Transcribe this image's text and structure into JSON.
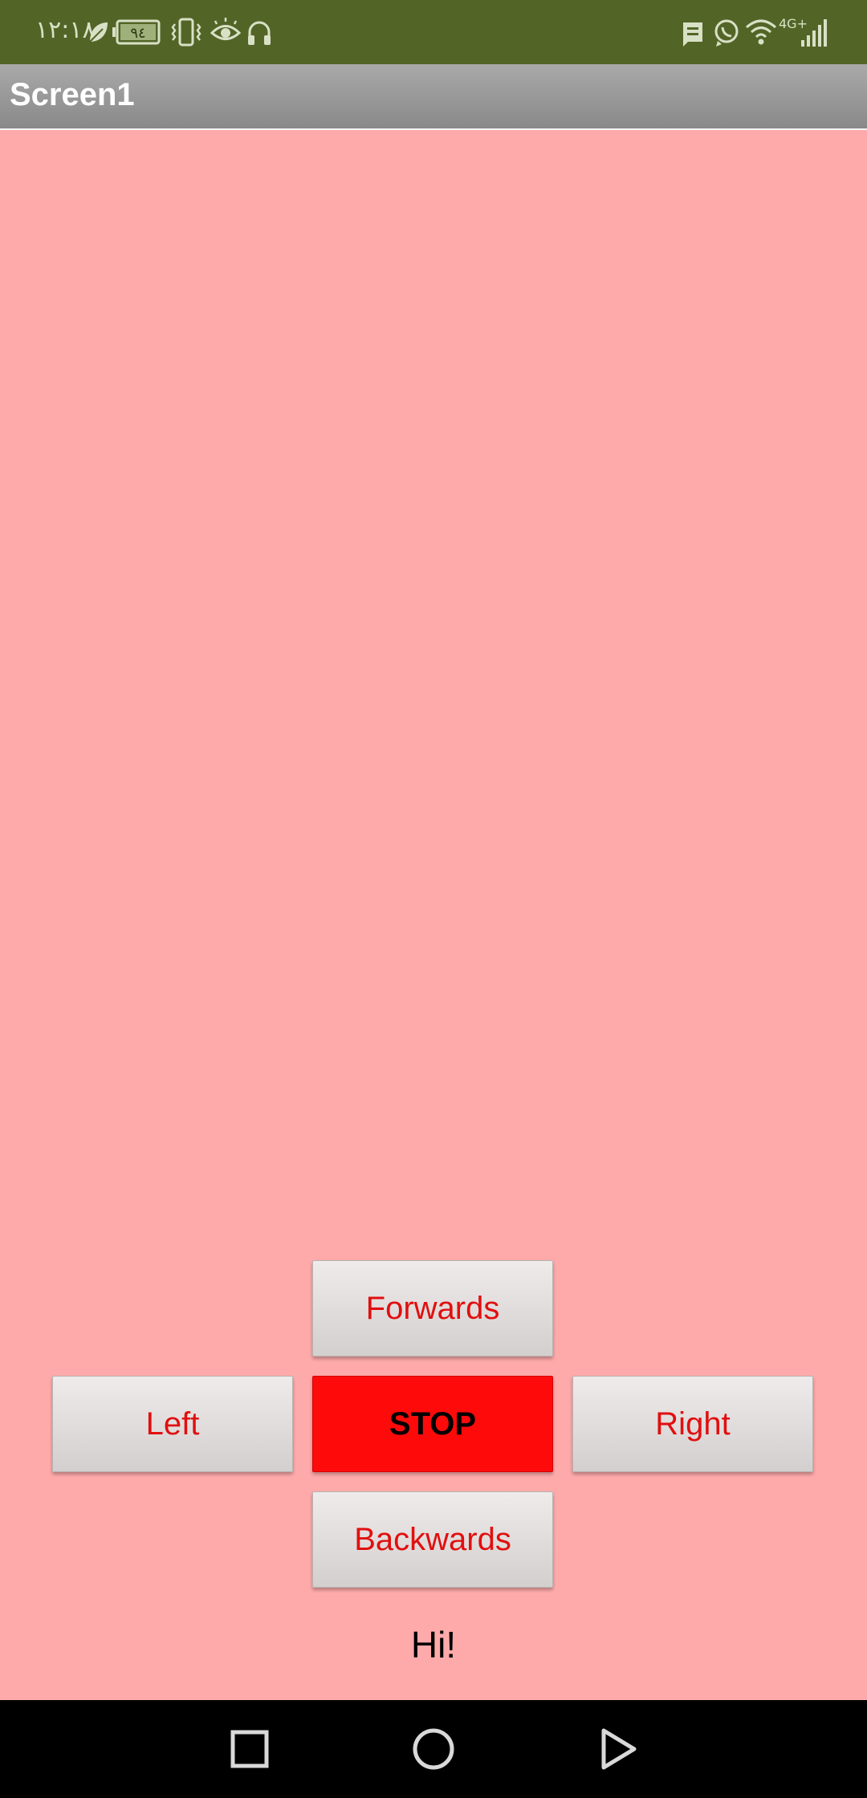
{
  "status_bar": {
    "time": "١٢:١٨",
    "battery": "٩٤",
    "network": "4G+",
    "left_icons": [
      "leaf-icon",
      "battery-icon",
      "vibrate-icon",
      "eye-icon",
      "headphones-icon"
    ],
    "right_icons": [
      "message-icon",
      "whatsapp-icon",
      "wifi-icon",
      "cellular-signal-icon"
    ]
  },
  "app_bar": {
    "title": "Screen1"
  },
  "controls": {
    "forwards": "Forwards",
    "left": "Left",
    "stop": "STOP",
    "right": "Right",
    "backwards": "Backwards"
  },
  "message": "Hi!",
  "colors": {
    "status_bar": "#536526",
    "background": "#ffaaaa",
    "button_text": "#e10f0f",
    "stop_button": "#ff0a0a",
    "nav_bar": "#000000"
  },
  "nav_bar": {
    "items": [
      "recents-icon",
      "home-icon",
      "back-icon"
    ]
  }
}
